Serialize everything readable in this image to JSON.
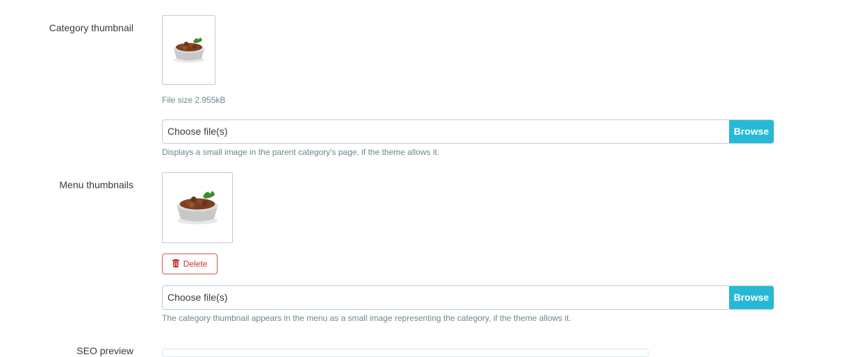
{
  "category_thumbnail": {
    "label": "Category thumbnail",
    "file_size": "File size 2.955kB",
    "file_placeholder": "Choose file(s)",
    "browse_label": "Browse",
    "help": "Displays a small image in the parent category's page, if the theme allows it."
  },
  "menu_thumbnails": {
    "label": "Menu thumbnails",
    "delete_label": "Delete",
    "file_placeholder": "Choose file(s)",
    "browse_label": "Browse",
    "help": "The category thumbnail appears in the menu as a small image representing the category, if the theme allows it."
  },
  "seo_preview": {
    "label": "SEO preview"
  },
  "colors": {
    "accent": "#25b9d7",
    "danger": "#c9302c",
    "border": "#bbcdd2",
    "help_text": "#6c868e"
  }
}
